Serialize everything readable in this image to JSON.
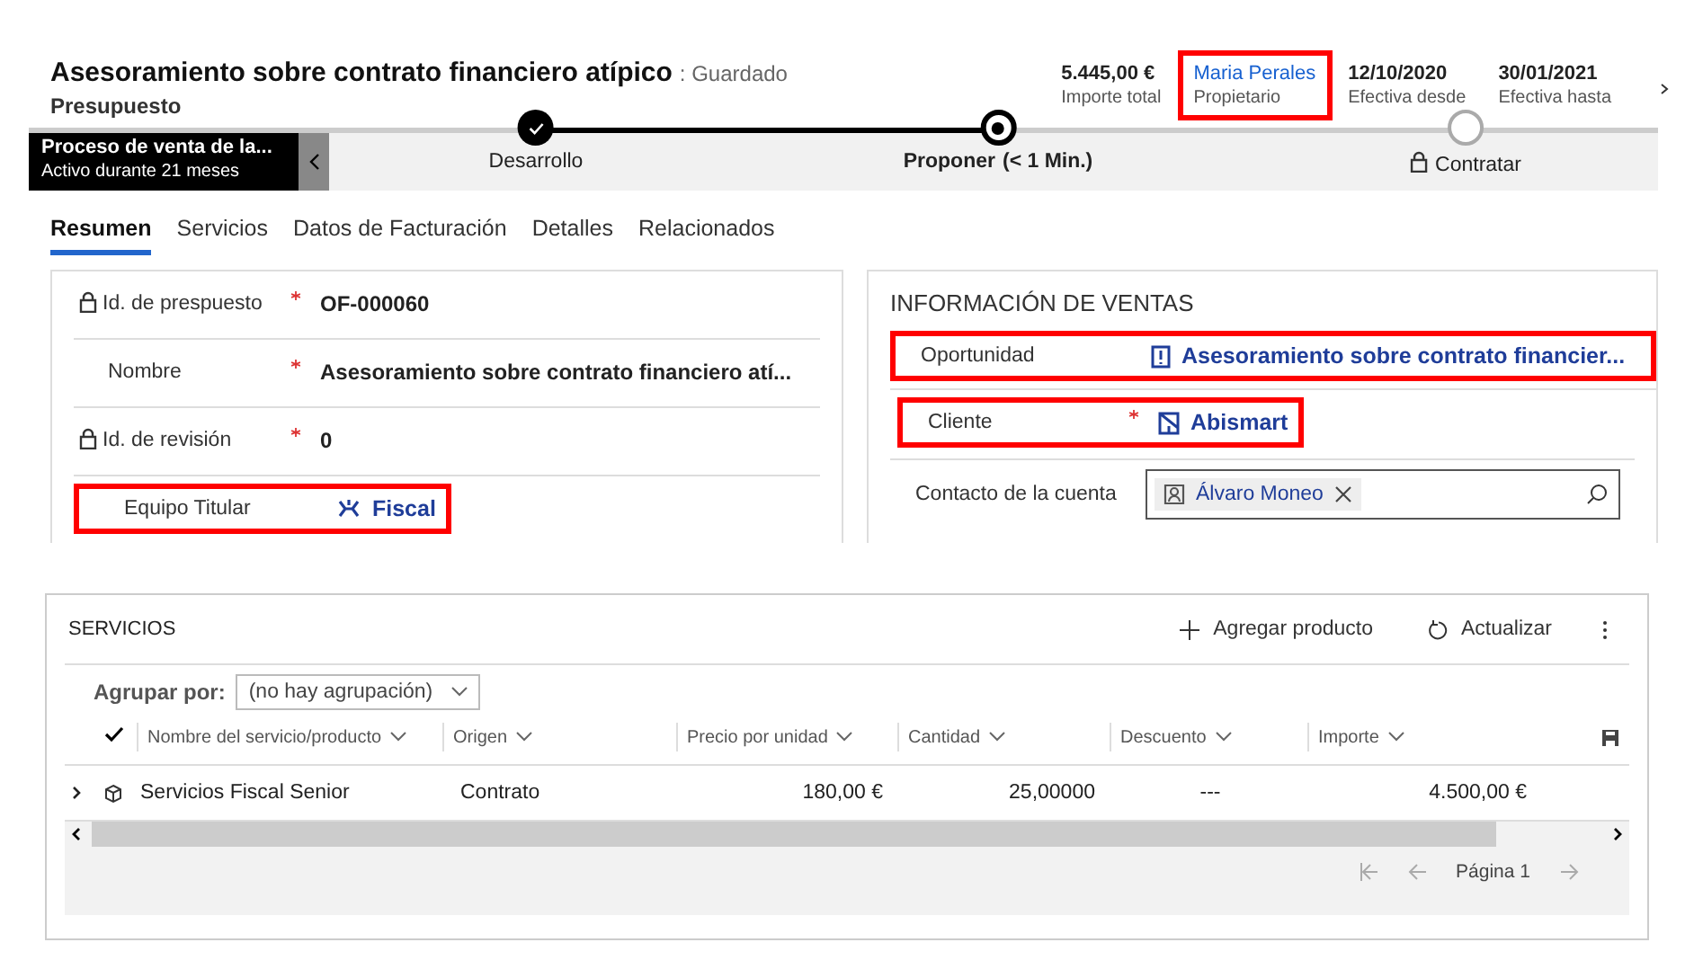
{
  "header": {
    "title": "Asesoramiento sobre contrato financiero atípico",
    "status": ": Guardado",
    "subtitle": "Presupuesto",
    "stats": [
      {
        "value": "5.445,00 €",
        "label": "Importe total",
        "kind": "plain",
        "highlighted": false
      },
      {
        "value": "Maria Perales",
        "label": "Propietario",
        "kind": "link",
        "highlighted": true
      },
      {
        "value": "12/10/2020",
        "label": "Efectiva desde",
        "kind": "plain",
        "highlighted": false
      },
      {
        "value": "30/01/2021",
        "label": "Efectiva hasta",
        "kind": "plain",
        "highlighted": false
      }
    ]
  },
  "process": {
    "name": "Proceso de venta de la...",
    "duration": "Activo durante 21 meses",
    "stages": [
      {
        "label": "Desarrollo",
        "completed": true,
        "selected": false,
        "locked": false
      },
      {
        "label": "Proponer",
        "note": "(< 1 Min.)",
        "completed": false,
        "selected": true,
        "locked": false
      },
      {
        "label": "Contratar",
        "completed": false,
        "selected": false,
        "locked": true
      }
    ]
  },
  "tabs": [
    {
      "label": "Resumen",
      "selected": true
    },
    {
      "label": "Servicios",
      "selected": false
    },
    {
      "label": "Datos de Facturación",
      "selected": false
    },
    {
      "label": "Detalles",
      "selected": false
    },
    {
      "label": "Relacionados",
      "selected": false
    }
  ],
  "summary_fields": [
    {
      "label": "Id. de prespuesto",
      "locked": true,
      "required": true,
      "value": "OF-000060",
      "kind": "text",
      "highlighted": false
    },
    {
      "label": "Nombre",
      "locked": false,
      "required": true,
      "value": "Asesoramiento sobre contrato financiero atí...",
      "kind": "text",
      "highlighted": false
    },
    {
      "label": "Id. de revisión",
      "locked": true,
      "required": true,
      "value": "0",
      "kind": "text",
      "highlighted": false
    },
    {
      "label": "Equipo Titular",
      "locked": false,
      "required": false,
      "value": "Fiscal",
      "kind": "team",
      "highlighted": true
    }
  ],
  "sales": {
    "title": "INFORMACIÓN DE VENTAS",
    "fields": [
      {
        "label": "Oportunidad",
        "required": false,
        "value": "Asesoramiento sobre contrato financier...",
        "kind": "opportunity",
        "highlighted": true
      },
      {
        "label": "Cliente",
        "required": true,
        "value": "Abismart",
        "kind": "account",
        "highlighted": true
      },
      {
        "label": "Contacto de la cuenta",
        "required": false,
        "value": "Álvaro Moneo",
        "kind": "contact",
        "highlighted": false
      }
    ]
  },
  "services": {
    "title": "SERVICIOS",
    "actions": [
      {
        "label": "Agregar producto",
        "kind": "add"
      },
      {
        "label": "Actualizar",
        "kind": "refresh"
      }
    ],
    "group_by": {
      "label": "Agrupar por:",
      "value": "(no hay agrupación)"
    },
    "columns": [
      "Nombre del servicio/producto",
      "Origen",
      "Precio por unidad",
      "Cantidad",
      "Descuento",
      "Importe"
    ],
    "rows": [
      {
        "cells": [
          "Servicios Fiscal Senior",
          "Contrato",
          "180,00 €",
          "25,00000",
          "---",
          "4.500,00 €"
        ],
        "expanded": false
      }
    ],
    "pager": "Página 1"
  }
}
